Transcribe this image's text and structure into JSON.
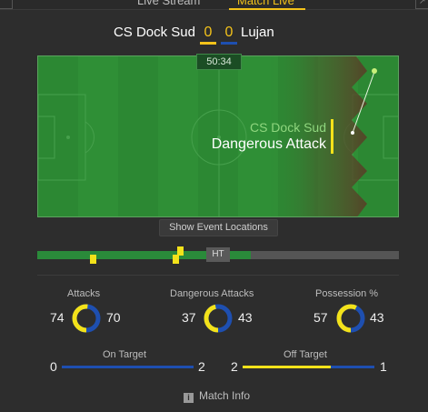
{
  "tabs": {
    "live_stream": "Live Stream",
    "match_live": "Match Live"
  },
  "teams": {
    "home": "CS Dock Sud",
    "away": "Lujan"
  },
  "score": {
    "home": "0",
    "away": "0"
  },
  "clock": "50:34",
  "event": {
    "team": "CS Dock Sud",
    "name": "Dangerous Attack"
  },
  "show_events_label": "Show Event Locations",
  "timeline": {
    "ht_label": "HT",
    "progress_fraction": 0.59
  },
  "stats": {
    "attacks": {
      "label": "Attacks",
      "home": "74",
      "away": "70",
      "home_fraction": 0.514
    },
    "dangerous": {
      "label": "Dangerous Attacks",
      "home": "37",
      "away": "43",
      "home_fraction": 0.4625
    },
    "possession": {
      "label": "Possession %",
      "home": "57",
      "away": "43",
      "home_fraction": 0.57
    }
  },
  "bars": {
    "on_target": {
      "label": "On Target",
      "home": "0",
      "away": "2",
      "home_fraction": 0.0
    },
    "off_target": {
      "label": "Off Target",
      "home": "2",
      "away": "1",
      "home_fraction": 0.667
    }
  },
  "match_info_label": "Match Info",
  "colors": {
    "home": "#f3e21a",
    "away": "#1e4fb0",
    "accent": "#f3c21a",
    "pitch": "#2f8f36"
  },
  "icons": {
    "info": "info-icon"
  }
}
